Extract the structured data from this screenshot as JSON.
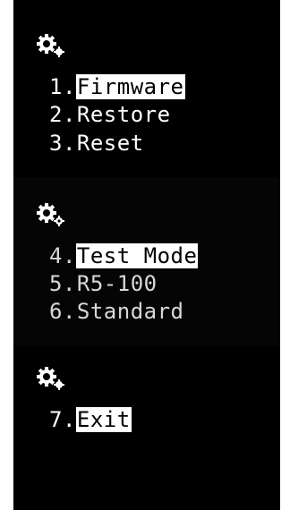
{
  "screens": [
    {
      "icon": "settings-gear-icon",
      "items": [
        {
          "num": "1.",
          "label": "Firmware",
          "selected": true
        },
        {
          "num": "2.",
          "label": "Restore",
          "selected": false
        },
        {
          "num": "3.",
          "label": "Reset",
          "selected": false
        }
      ]
    },
    {
      "icon": "settings-gear-icon",
      "items": [
        {
          "num": "4.",
          "label": "Test Mode",
          "selected": true
        },
        {
          "num": "5.",
          "label": "R5-100",
          "selected": false
        },
        {
          "num": "6.",
          "label": "Standard",
          "selected": false
        }
      ]
    },
    {
      "icon": "settings-gear-icon",
      "items": [
        {
          "num": "7.",
          "label": "Exit",
          "selected": true
        }
      ]
    }
  ],
  "colors": {
    "background": "#000000",
    "text": "#ffffff",
    "highlight": "#ffffff",
    "highlight_text": "#000000"
  }
}
